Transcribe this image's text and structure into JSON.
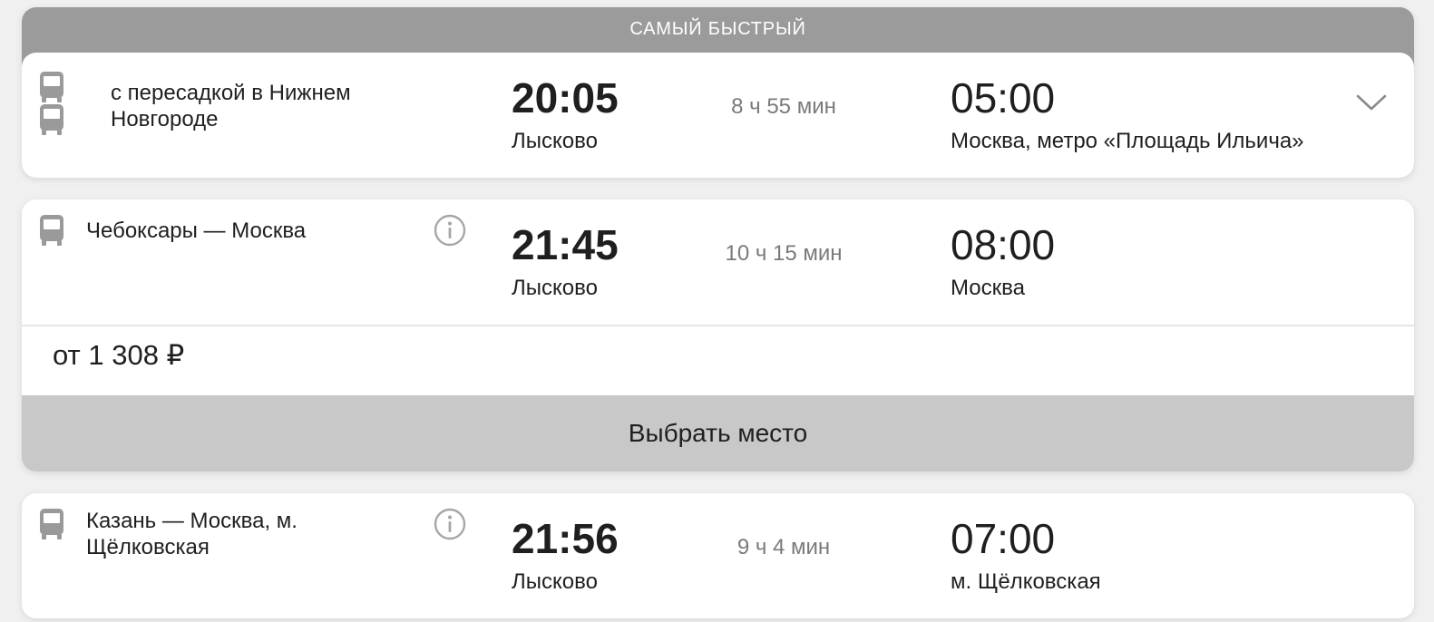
{
  "colors": {
    "banner_bg": "#9b9b9b",
    "button_bg": "#c8c8c8",
    "icon_gray": "#9a9a9a",
    "duration_text": "#7a7a7a"
  },
  "trips": [
    {
      "badge": "САМЫЙ БЫСТРЫЙ",
      "route": "с пересадкой в Нижнем Новгороде",
      "icons": [
        "bus-icon",
        "bus-icon"
      ],
      "departure_time": "20:05",
      "departure_station": "Лысково",
      "duration": "8 ч 55 мин",
      "arrival_time": "05:00",
      "arrival_station": "Москва, метро «Площадь Ильича»",
      "expand_icon": "chevron-down-icon"
    },
    {
      "route": "Чебоксары — Москва",
      "icons": [
        "bus-icon"
      ],
      "info_icon": "info-icon",
      "departure_time": "21:45",
      "departure_station": "Лысково",
      "duration": "10 ч 15 мин",
      "arrival_time": "08:00",
      "arrival_station": "Москва",
      "price": "от 1 308 ₽",
      "button_label": "Выбрать место"
    },
    {
      "route": "Казань — Москва, м. Щёлковская",
      "icons": [
        "bus-icon"
      ],
      "info_icon": "info-icon",
      "departure_time": "21:56",
      "departure_station": "Лысково",
      "duration": "9 ч 4 мин",
      "arrival_time": "07:00",
      "arrival_station": "м. Щёлковская"
    }
  ]
}
